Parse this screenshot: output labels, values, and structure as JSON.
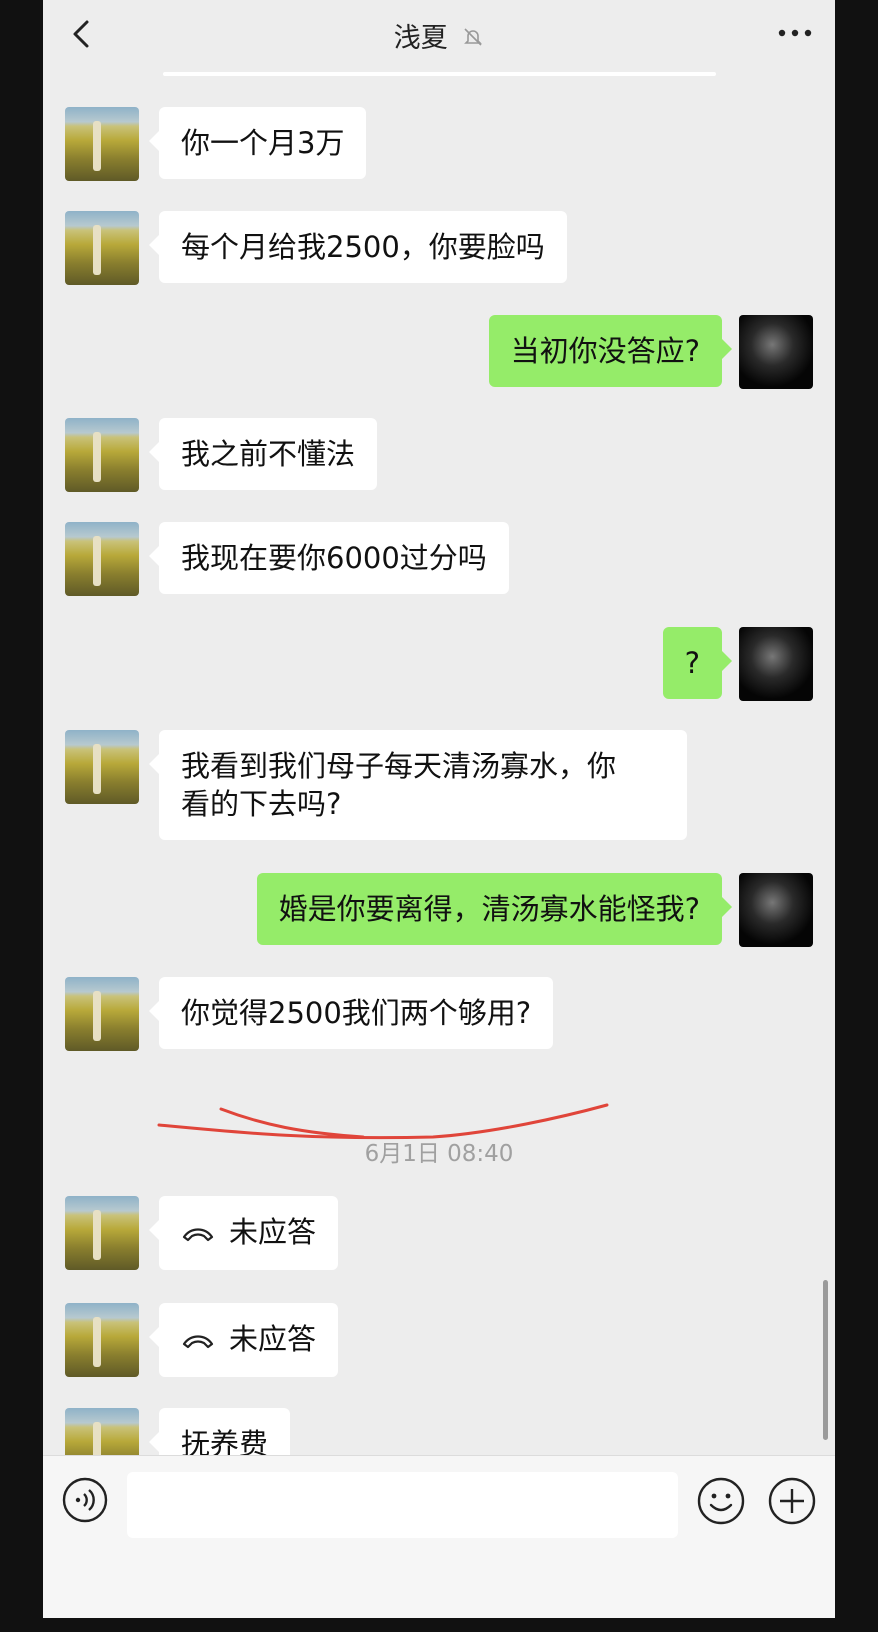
{
  "header": {
    "title": "浅夏"
  },
  "messages": [
    {
      "side": "in",
      "text": "你一个月3万"
    },
    {
      "side": "in",
      "text": "每个月给我2500，你要脸吗"
    },
    {
      "side": "out",
      "text": "当初你没答应?"
    },
    {
      "side": "in",
      "text": "我之前不懂法"
    },
    {
      "side": "in",
      "text": "我现在要你6000过分吗"
    },
    {
      "side": "out",
      "text": "?"
    },
    {
      "side": "in",
      "text_line1": "我看到我们母子每天清汤寡水，你",
      "text_line2": "看的下去吗?"
    },
    {
      "side": "out",
      "text": "婚是你要离得，清汤寡水能怪我?"
    },
    {
      "side": "in",
      "text": "你觉得2500我们两个够用?"
    },
    {
      "side": "in",
      "type": "missed-call",
      "text": "未应答"
    },
    {
      "side": "in",
      "type": "missed-call",
      "text": "未应答"
    },
    {
      "side": "in",
      "text": "抚养费"
    }
  ],
  "timestamp": "6月1日 08:40",
  "input": {
    "placeholder": ""
  },
  "icons": {
    "back": "chevron-left-icon",
    "mute": "bell-off-icon",
    "more": "more-dots-icon",
    "voice": "voice-icon",
    "emoji": "emoji-icon",
    "plus": "plus-icon",
    "call": "phone-hangup-icon"
  },
  "colors": {
    "outgoing_bubble": "#95ec69",
    "incoming_bubble": "#ffffff",
    "background": "#ededed",
    "scribble": "#e0453a"
  }
}
